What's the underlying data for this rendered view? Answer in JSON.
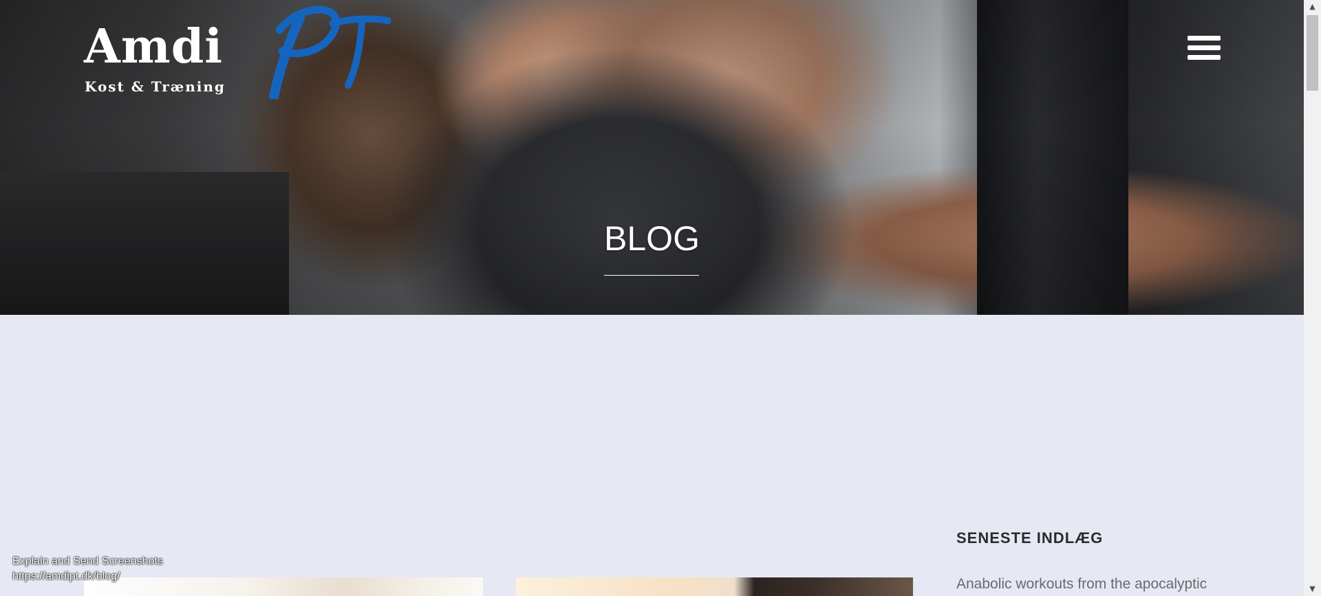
{
  "header": {
    "logo": {
      "brand_main": "Amdi",
      "brand_pt": "PT",
      "tagline": "Kost & Træning",
      "brand_color": "#1565c0"
    },
    "menu_icon": "hamburger-menu-icon"
  },
  "hero": {
    "title": "BLOG"
  },
  "sidebar": {
    "heading": "SENESTE INDLÆG",
    "recent_posts": [
      "Anabolic workouts from the apocalyptic"
    ]
  },
  "status_overlay": {
    "line1": "Explain and Send Screenshots",
    "line2": "https://amdipt.dk/blog/"
  },
  "colors": {
    "page_background": "#e6e9f4",
    "hero_text": "#ffffff",
    "heading_text": "#2b2b2b",
    "post_text": "#6a6a6a"
  }
}
